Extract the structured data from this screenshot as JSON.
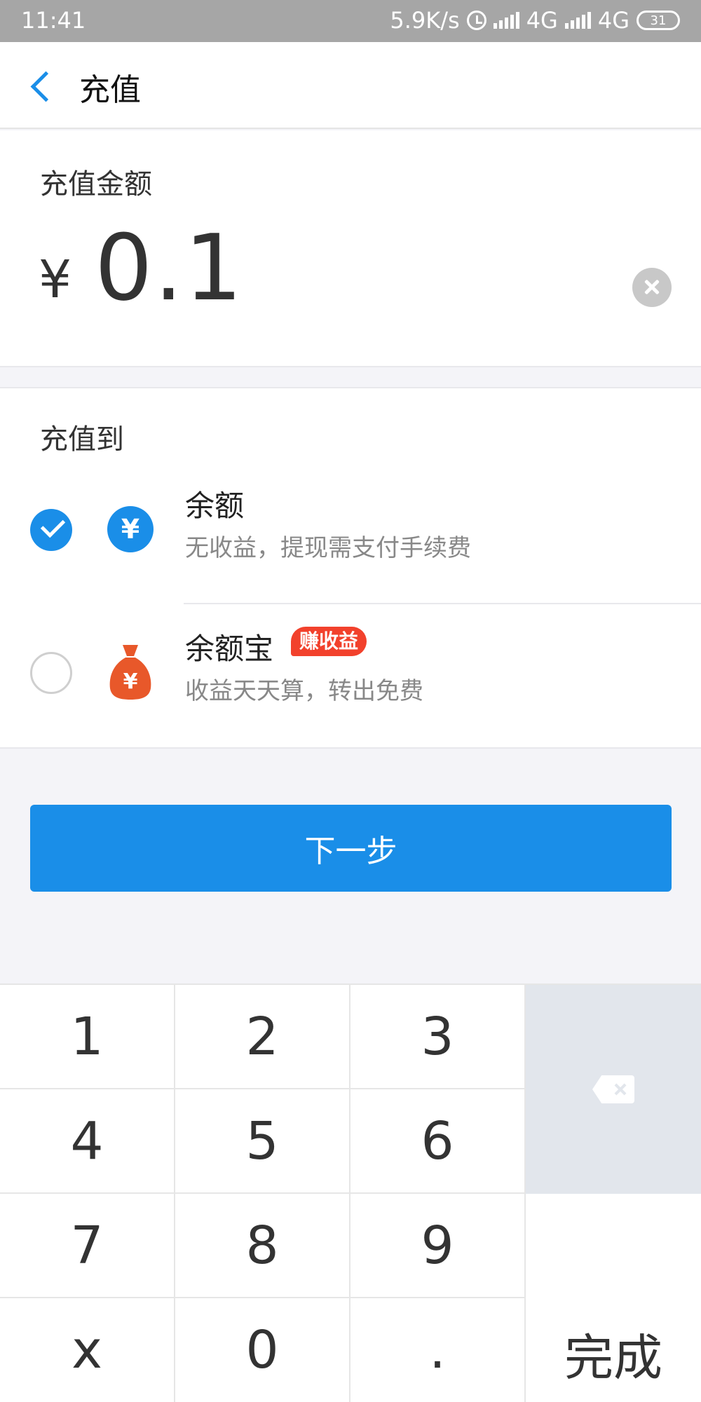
{
  "status_bar": {
    "time": "11:41",
    "speed": "5.9K/s",
    "network1": "4G",
    "network2": "4G",
    "battery": "31"
  },
  "nav": {
    "title": "充值"
  },
  "amount": {
    "label": "充值金额",
    "currency": "¥",
    "value": "0.1"
  },
  "recharge_to": {
    "label": "充值到",
    "options": [
      {
        "title": "余额",
        "desc": "无收益，提现需支付手续费",
        "selected": true,
        "icon": "yuan-circle-icon"
      },
      {
        "title": "余额宝",
        "badge": "赚收益",
        "desc": "收益天天算，转出免费",
        "selected": false,
        "icon": "money-bag-icon"
      }
    ]
  },
  "next_button": "下一步",
  "keypad": {
    "keys": [
      "1",
      "2",
      "3",
      "4",
      "5",
      "6",
      "7",
      "8",
      "9",
      "x",
      "0",
      "."
    ],
    "done": "完成"
  },
  "colors": {
    "accent": "#1a8ee8",
    "badge": "#f2412c",
    "bag": "#e8582a"
  }
}
